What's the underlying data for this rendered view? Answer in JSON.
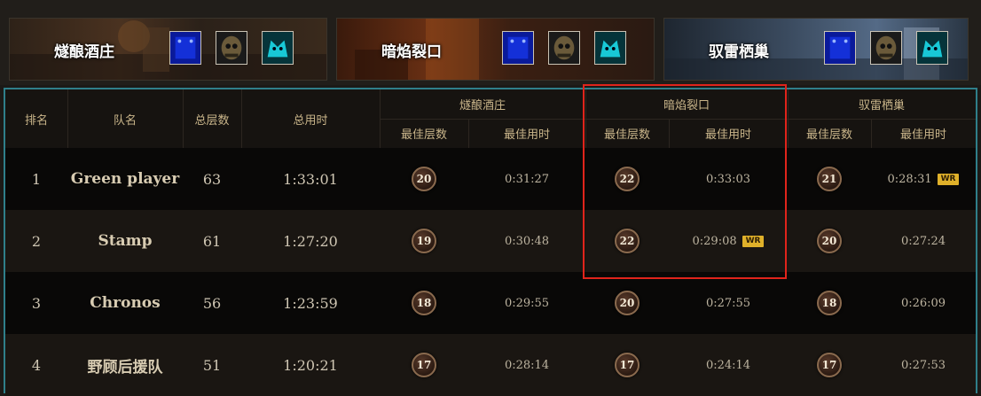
{
  "banners": [
    {
      "name": "燧酿酒庄",
      "affix_icons": [
        "blue-rune-icon",
        "skull-shield-icon",
        "cyan-beast-icon"
      ],
      "bg": "#3b2a1c",
      "accent": "#7a4a22"
    },
    {
      "name": "暗焰裂口",
      "affix_icons": [
        "blue-rune-icon",
        "skull-shield-icon",
        "cyan-beast-icon"
      ],
      "bg": "#3a1e10",
      "accent": "#a8561f"
    },
    {
      "name": "驭雷栖巢",
      "affix_icons": [
        "blue-rune-icon",
        "skull-shield-icon",
        "cyan-beast-icon"
      ],
      "bg": "#2a3440",
      "accent": "#7c94b3"
    }
  ],
  "headers": {
    "rank": "排名",
    "team": "队名",
    "total_levels": "总层数",
    "total_time": "总用时",
    "dungeons": [
      "燧酿酒庄",
      "暗焰裂口",
      "驭雷栖巢"
    ],
    "best_level": "最佳层数",
    "best_time": "最佳用时"
  },
  "rows": [
    {
      "rank": "1",
      "team": "Green player",
      "total": "63",
      "time": "1:33:01",
      "d": [
        {
          "level": "20",
          "time": "0:31:27",
          "wr": ""
        },
        {
          "level": "22",
          "time": "0:33:03",
          "wr": ""
        },
        {
          "level": "21",
          "time": "0:28:31",
          "wr": "WR"
        }
      ]
    },
    {
      "rank": "2",
      "team": "Stamp",
      "total": "61",
      "time": "1:27:20",
      "d": [
        {
          "level": "19",
          "time": "0:30:48",
          "wr": ""
        },
        {
          "level": "22",
          "time": "0:29:08",
          "wr": "WR"
        },
        {
          "level": "20",
          "time": "0:27:24",
          "wr": ""
        }
      ]
    },
    {
      "rank": "3",
      "team": "Chronos",
      "total": "56",
      "time": "1:23:59",
      "d": [
        {
          "level": "18",
          "time": "0:29:55",
          "wr": ""
        },
        {
          "level": "20",
          "time": "0:27:55",
          "wr": ""
        },
        {
          "level": "18",
          "time": "0:26:09",
          "wr": ""
        }
      ]
    },
    {
      "rank": "4",
      "team": "野顾后援队",
      "total": "51",
      "time": "1:20:21",
      "d": [
        {
          "level": "17",
          "time": "0:28:14",
          "wr": ""
        },
        {
          "level": "17",
          "time": "0:24:14",
          "wr": ""
        },
        {
          "level": "17",
          "time": "0:27:53",
          "wr": ""
        }
      ]
    }
  ],
  "colors": {
    "frame": "#2f7f8a",
    "highlight": "#e0241b",
    "wr_badge": "#e0b12a",
    "header_text": "#c9b58a"
  }
}
